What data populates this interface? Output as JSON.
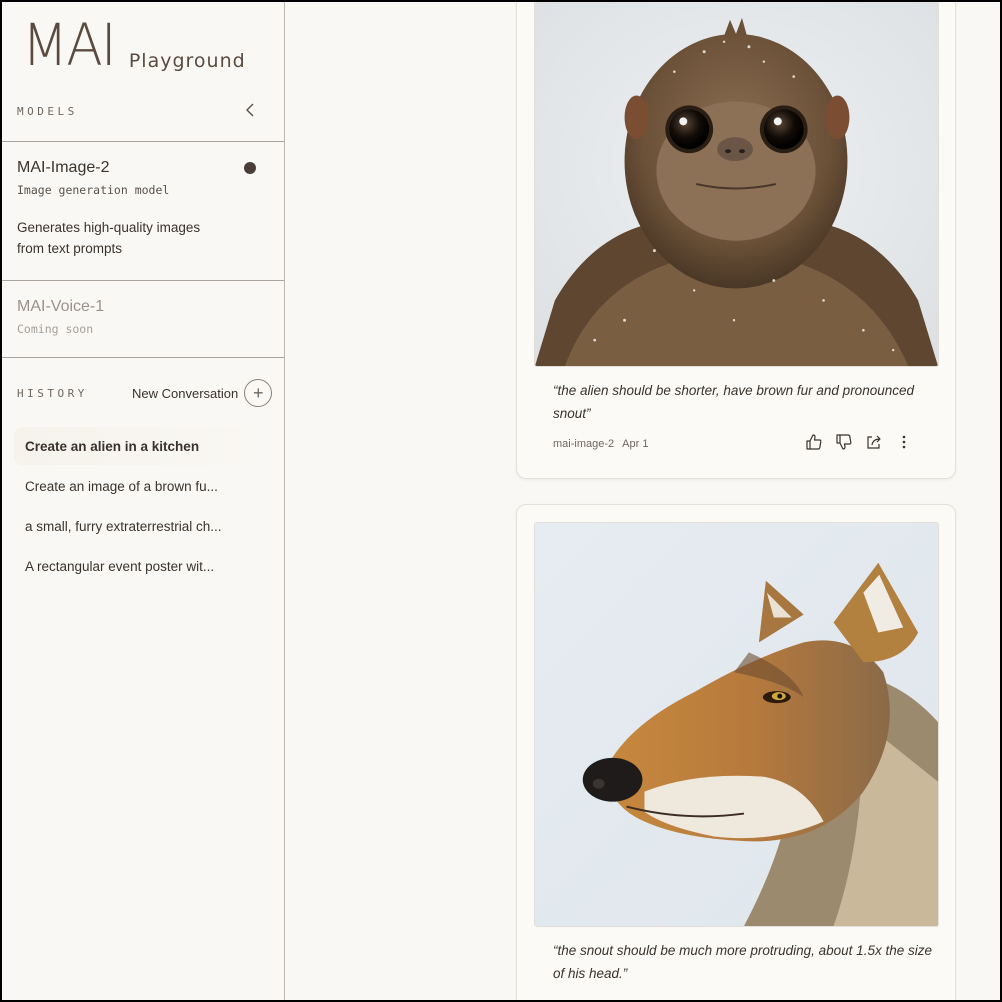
{
  "brand": {
    "logo": "MAI",
    "subtitle": "Playground"
  },
  "sidebar": {
    "models_label": "MODELS",
    "models": [
      {
        "name": "MAI-Image-2",
        "type": "Image generation model",
        "description": "Generates high-quality images from text prompts",
        "active": true
      },
      {
        "name": "MAI-Voice-1",
        "type": "Coming soon",
        "active": false
      }
    ],
    "history_label": "HISTORY",
    "new_conversation_label": "New Conversation",
    "history": [
      {
        "label": "Create an alien in a kitchen",
        "active": true
      },
      {
        "label": "Create an image of a brown fu..."
      },
      {
        "label": "a small, furry extraterrestrial ch..."
      },
      {
        "label": "A rectangular event poster wit..."
      }
    ]
  },
  "feed": [
    {
      "image": "furry-alien-creature-image",
      "prompt": "“the alien should be shorter, have brown fur and pronounced snout”",
      "model": "mai-image-2",
      "date": "Apr 1"
    },
    {
      "image": "wolf-profile-image",
      "prompt": "“the snout should be much more protruding, about 1.5x the size of his head.”"
    }
  ],
  "icons": [
    "chevron-left-icon",
    "plus-icon",
    "thumbs-up-icon",
    "thumbs-down-icon",
    "share-icon",
    "more-icon"
  ],
  "colors": {
    "background": "#faf8f4",
    "text": "#3b322b",
    "brand": "#5a4b40",
    "active_dot": "#4a3f37"
  }
}
